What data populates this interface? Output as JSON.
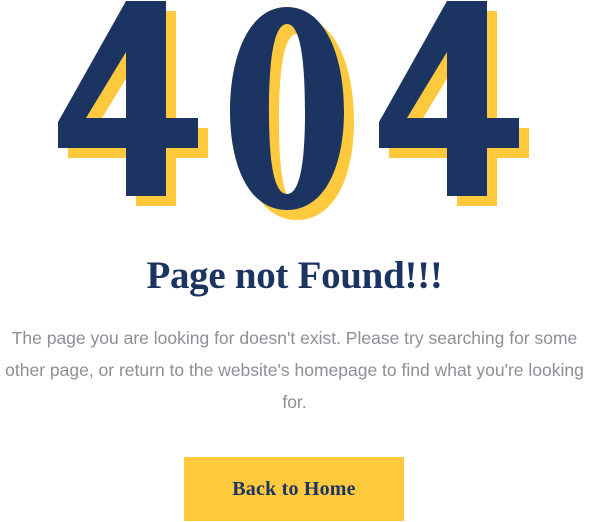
{
  "error": {
    "code": "404"
  },
  "page": {
    "headline": "Page not Found!!!",
    "message": "The page you are looking for doesn't exist. Please try searching for some other page, or return to the website's homepage to find what you're looking for.",
    "button_label": "Back to Home"
  },
  "colors": {
    "navy": "#1c3462",
    "accent_yellow": "#ffc93e",
    "text_gray": "#8e8e96"
  }
}
